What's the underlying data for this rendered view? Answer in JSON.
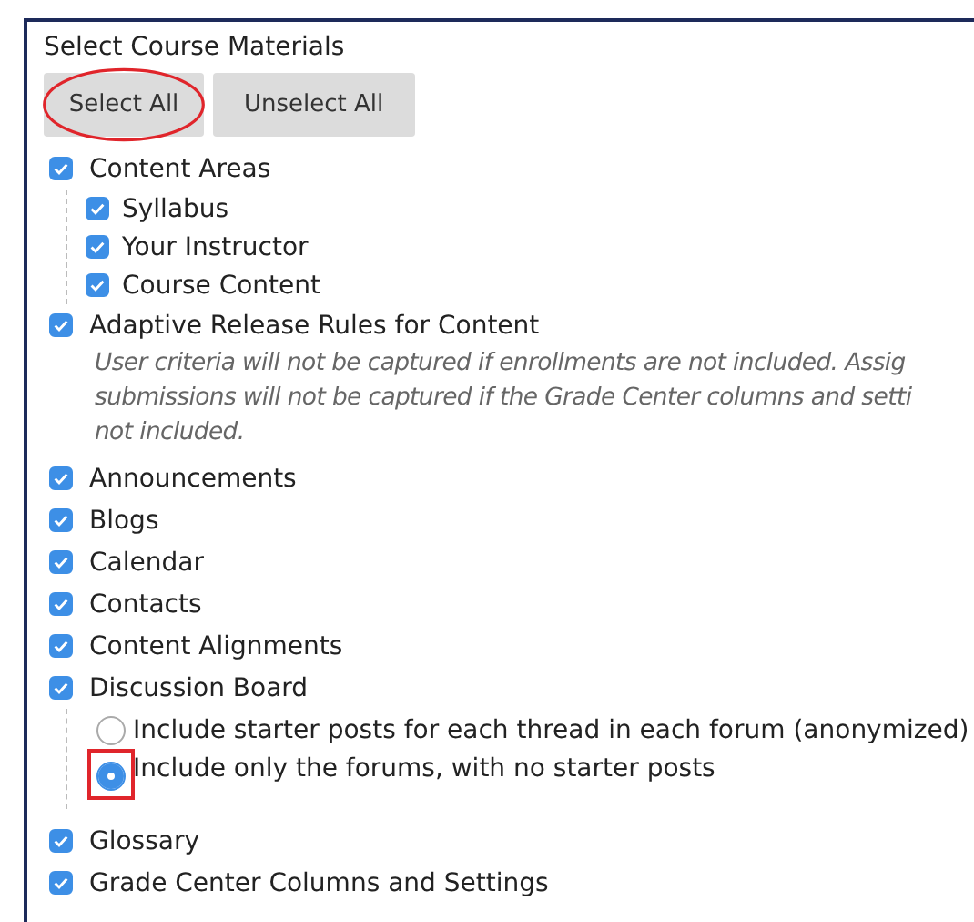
{
  "heading": "Select Course Materials",
  "buttons": [
    {
      "label": "Select All",
      "circled": true
    },
    {
      "label": "Unselect All",
      "circled": false
    }
  ],
  "items": [
    {
      "label": "Content Areas",
      "checked": true,
      "children": [
        {
          "label": "Syllabus",
          "checked": true
        },
        {
          "label": "Your Instructor",
          "checked": true
        },
        {
          "label": "Course Content",
          "checked": true
        }
      ]
    },
    {
      "label": "Adaptive Release Rules for Content",
      "checked": true,
      "note_lines": [
        "User criteria will not be captured if enrollments are not included. Assig",
        "submissions will not be captured if the Grade Center columns and setti",
        "not included."
      ]
    },
    {
      "label": "Announcements",
      "checked": true
    },
    {
      "label": "Blogs",
      "checked": true
    },
    {
      "label": "Calendar",
      "checked": true
    },
    {
      "label": "Contacts",
      "checked": true
    },
    {
      "label": "Content Alignments",
      "checked": true
    },
    {
      "label": "Discussion Board",
      "checked": true,
      "options": [
        {
          "label": "Include starter posts for each thread in each forum (anonymized)",
          "selected": false,
          "boxed": false
        },
        {
          "label": "Include only the forums, with no starter posts",
          "selected": true,
          "boxed": true
        }
      ]
    },
    {
      "label": "Glossary",
      "checked": true
    },
    {
      "label": "Grade Center Columns and Settings",
      "checked": true
    }
  ]
}
